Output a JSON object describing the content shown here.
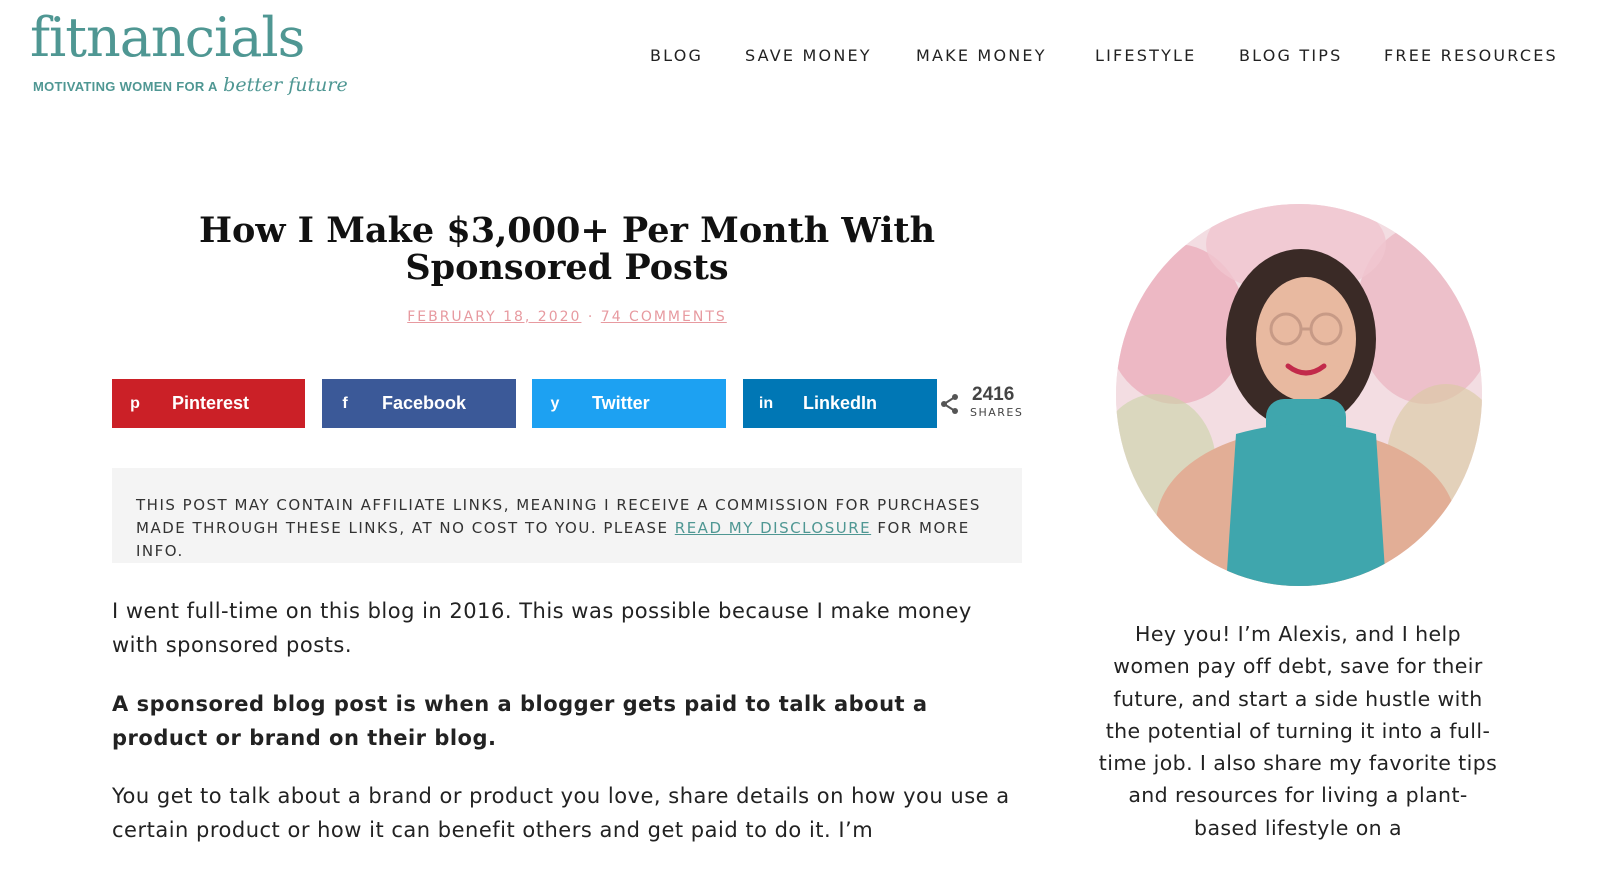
{
  "header": {
    "logo_text": "fitnancials",
    "logo_tagline": "MOTIVATING WOMEN FOR A",
    "logo_tagline_script": "better future",
    "brand_color": "#4f9793",
    "nav": [
      "BLOG",
      "SAVE MONEY",
      "MAKE MONEY",
      "LIFESTYLE",
      "BLOG TIPS",
      "FREE RESOURCES"
    ]
  },
  "article": {
    "title": "How I Make $3,000+ Per Month With Sponsored Posts",
    "date": "FEBRUARY 18, 2020",
    "separator": "·",
    "comments": "74 COMMENTS",
    "share_buttons": [
      {
        "label": "Pinterest",
        "icon": "pinterest-icon",
        "glyph": "p",
        "color": "#cb2027"
      },
      {
        "label": "Facebook",
        "icon": "facebook-icon",
        "glyph": "f",
        "color": "#3b5998"
      },
      {
        "label": "Twitter",
        "icon": "twitter-icon",
        "glyph": "y",
        "color": "#1da1f2"
      },
      {
        "label": "LinkedIn",
        "icon": "linkedin-icon",
        "glyph": "in",
        "color": "#0077b5"
      }
    ],
    "share_count": "2416",
    "share_count_label": "SHARES",
    "disclosure_text": "THIS POST MAY CONTAIN AFFILIATE LINKS, MEANING I RECEIVE A COMMISSION FOR PURCHASES MADE THROUGH THESE LINKS, AT NO COST TO YOU. PLEASE",
    "disclosure_link": "READ MY DISCLOSURE",
    "disclosure_end": "FOR MORE INFO.",
    "paragraph_1": "I went full-time on this blog in 2016. This was possible because I make money with sponsored posts.",
    "paragraph_2": "A sponsored blog post is when a blogger gets paid to talk about a product or brand on their blog.",
    "paragraph_3": "You get to talk about a brand or product you love, share details on how you use a certain product or how it can benefit others and get paid to do it. I’m"
  },
  "sidebar": {
    "bio": "Hey you! I’m Alexis, and I help women pay off debt, save for their future, and start a side hustle with the potential of turning it into a full-time job. I also share my favorite tips and resources for living a plant-based lifestyle on a"
  }
}
